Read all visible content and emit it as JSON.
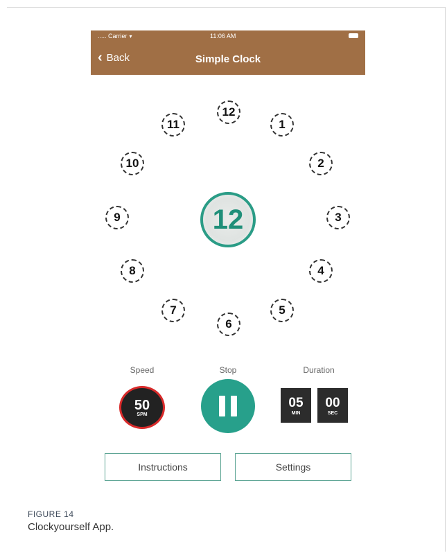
{
  "status_bar": {
    "carrier": "..... Carrier",
    "time": "11:06 AM"
  },
  "nav": {
    "back_label": "Back",
    "title": "Simple Clock"
  },
  "clock": {
    "hours": [
      "12",
      "1",
      "2",
      "3",
      "4",
      "5",
      "6",
      "7",
      "8",
      "9",
      "10",
      "11"
    ],
    "current": "12",
    "accent_color": "#2a9c86"
  },
  "controls": {
    "speed": {
      "label": "Speed",
      "value": "50",
      "unit": "SPM"
    },
    "stop": {
      "label": "Stop"
    },
    "duration": {
      "label": "Duration",
      "minutes": "05",
      "minutes_unit": "MIN",
      "seconds": "00",
      "seconds_unit": "SEC"
    }
  },
  "buttons": {
    "instructions": "Instructions",
    "settings": "Settings"
  },
  "figure": {
    "label": "FIGURE 14",
    "caption": "Clockyourself App."
  },
  "colors": {
    "nav_brown": "#a06f45",
    "teal": "#27a08b",
    "speed_ring_red": "#d82a2a"
  },
  "icons": {
    "back": "chevron-left-icon",
    "wifi": "wifi-icon",
    "battery": "battery-icon",
    "pause": "pause-icon"
  }
}
